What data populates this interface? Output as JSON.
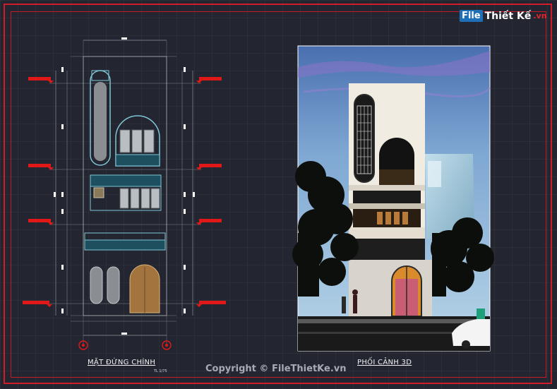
{
  "brand": {
    "logo_box": "File",
    "logo_word": "Thiết Kế",
    "logo_suffix": ".vn"
  },
  "elevation": {
    "title": "MẶT ĐỨNG CHÍNH",
    "scale": "TL 1/75"
  },
  "render": {
    "title": "PHỐI CẢNH 3D"
  },
  "watermark": "Copyright © FileThietKe.vn",
  "colors": {
    "background": "#232630",
    "frame": "#d11d2a",
    "linework": "#7fc6d8",
    "level_marker": "#e01818",
    "dimension": "#9aa0a6"
  }
}
